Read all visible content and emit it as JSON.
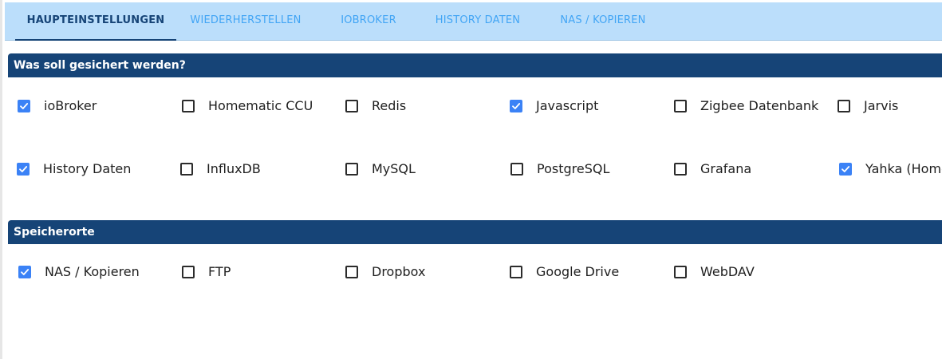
{
  "tabs": [
    {
      "label": "HAUPTEINSTELLUNGEN",
      "active": true
    },
    {
      "label": "WIEDERHERSTELLEN",
      "active": false
    },
    {
      "label": "IOBROKER",
      "active": false
    },
    {
      "label": "HISTORY DATEN",
      "active": false
    },
    {
      "label": "NAS / KOPIEREN",
      "active": false
    }
  ],
  "sections": {
    "backup": {
      "title": "Was soll gesichert werden?",
      "items": [
        {
          "label": "ioBroker",
          "checked": true
        },
        {
          "label": "Homematic CCU",
          "checked": false
        },
        {
          "label": "Redis",
          "checked": false
        },
        {
          "label": "Javascript",
          "checked": true
        },
        {
          "label": "Zigbee Datenbank",
          "checked": false
        },
        {
          "label": "Jarvis",
          "checked": false
        },
        {
          "label": "History Daten",
          "checked": true
        },
        {
          "label": "InfluxDB",
          "checked": false
        },
        {
          "label": "MySQL",
          "checked": false
        },
        {
          "label": "PostgreSQL",
          "checked": false
        },
        {
          "label": "Grafana",
          "checked": false
        },
        {
          "label": "Yahka (Homekit)",
          "checked": true
        }
      ]
    },
    "storage": {
      "title": "Speicherorte",
      "items": [
        {
          "label": "NAS / Kopieren",
          "checked": true
        },
        {
          "label": "FTP",
          "checked": false
        },
        {
          "label": "Dropbox",
          "checked": false
        },
        {
          "label": "Google Drive",
          "checked": false
        },
        {
          "label": "WebDAV",
          "checked": false
        }
      ]
    }
  },
  "colors": {
    "tabbar_bg": "#bbdefb",
    "tab_inactive": "#42a5f5",
    "tab_active": "#164477",
    "section_header_bg": "#164477",
    "checkbox_checked": "#3b82f6"
  },
  "icons": {
    "checked": "check-icon",
    "unchecked": "empty-box-icon"
  }
}
